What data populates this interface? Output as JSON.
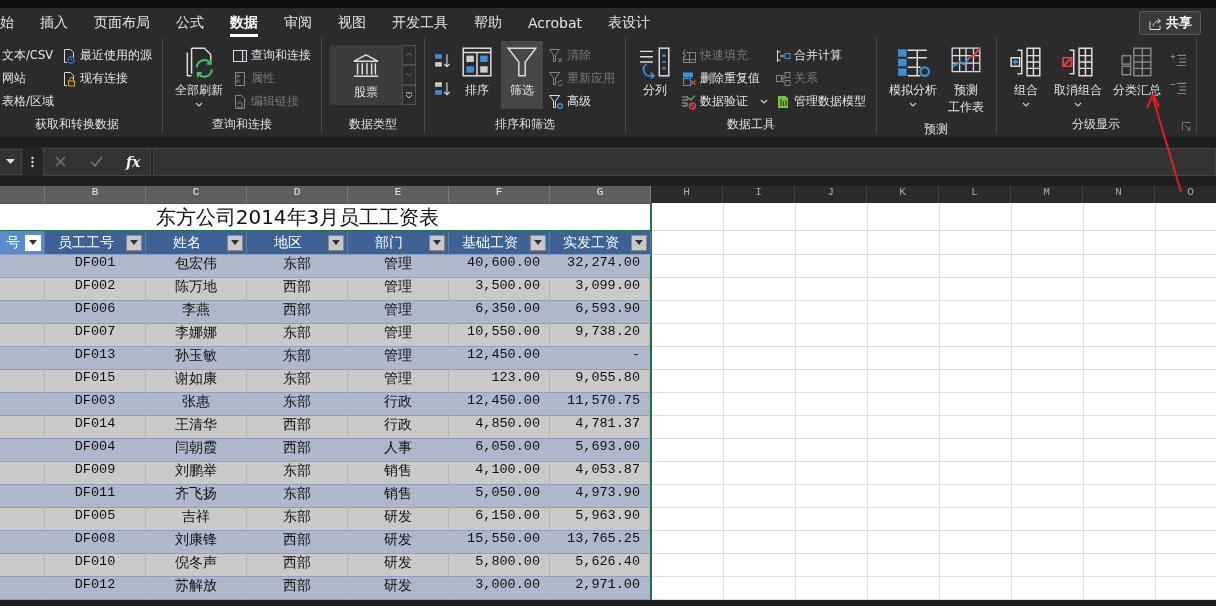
{
  "tabs": [
    {
      "label": "始",
      "selected": false
    },
    {
      "label": "插入",
      "selected": false
    },
    {
      "label": "页面布局",
      "selected": false
    },
    {
      "label": "公式",
      "selected": false
    },
    {
      "label": "数据",
      "selected": true
    },
    {
      "label": "审阅",
      "selected": false
    },
    {
      "label": "视图",
      "selected": false
    },
    {
      "label": "开发工具",
      "selected": false
    },
    {
      "label": "帮助",
      "selected": false
    },
    {
      "label": "Acrobat",
      "selected": false
    },
    {
      "label": "表设计",
      "selected": false
    }
  ],
  "share_button": {
    "label": "共享"
  },
  "ribbon": {
    "groups": [
      {
        "label": "获取和转换数据",
        "launcher": false,
        "columns": [
          {
            "kind": "stack",
            "items": [
              {
                "label": "文本/CSV",
                "disabled": false,
                "dropdown": false
              },
              {
                "label": "网站",
                "disabled": false,
                "dropdown": false
              },
              {
                "label": "表格/区域",
                "disabled": false,
                "dropdown": false
              }
            ]
          },
          {
            "kind": "stack",
            "items": [
              {
                "label": "最近使用的源",
                "disabled": false,
                "dropdown": false
              },
              {
                "label": "现有连接",
                "disabled": false,
                "dropdown": false
              }
            ]
          }
        ]
      },
      {
        "label": "查询和连接",
        "launcher": false,
        "columns": [
          {
            "kind": "large",
            "items": [
              {
                "lines": [
                  "全部刷新"
                ],
                "disabled": false,
                "dropdown": true,
                "pressed": false
              }
            ]
          },
          {
            "kind": "stack",
            "items": [
              {
                "label": "查询和连接",
                "disabled": false,
                "dropdown": false
              },
              {
                "label": "属性",
                "disabled": true,
                "dropdown": false
              },
              {
                "label": "编辑链接",
                "disabled": true,
                "dropdown": false
              }
            ]
          }
        ]
      },
      {
        "label": "数据类型",
        "launcher": false,
        "columns": [
          {
            "kind": "gallery",
            "items": [
              {
                "label": "股票"
              }
            ]
          }
        ]
      },
      {
        "label": "排序和筛选",
        "launcher": false,
        "columns": [
          {
            "kind": "icons",
            "items": [
              {
                "disabled": false
              },
              {
                "disabled": false
              }
            ]
          },
          {
            "kind": "large",
            "items": [
              {
                "lines": [
                  "排序"
                ],
                "disabled": false,
                "dropdown": false,
                "pressed": false
              }
            ]
          },
          {
            "kind": "large",
            "items": [
              {
                "lines": [
                  "筛选"
                ],
                "disabled": false,
                "dropdown": false,
                "pressed": true
              }
            ]
          },
          {
            "kind": "stack",
            "items": [
              {
                "label": "清除",
                "disabled": true,
                "dropdown": false
              },
              {
                "label": "重新应用",
                "disabled": true,
                "dropdown": false
              },
              {
                "label": "高级",
                "disabled": false,
                "dropdown": false
              }
            ]
          }
        ]
      },
      {
        "label": "数据工具",
        "launcher": false,
        "columns": [
          {
            "kind": "large",
            "items": [
              {
                "lines": [
                  "分列"
                ],
                "disabled": false,
                "dropdown": false,
                "pressed": false
              }
            ]
          },
          {
            "kind": "stack",
            "items": [
              {
                "label": "快速填充",
                "disabled": true,
                "dropdown": false
              },
              {
                "label": "删除重复值",
                "disabled": false,
                "dropdown": false
              },
              {
                "label": "数据验证",
                "disabled": false,
                "dropdown": true
              }
            ]
          },
          {
            "kind": "stack",
            "items": [
              {
                "label": "合并计算",
                "disabled": false,
                "dropdown": false
              },
              {
                "label": "关系",
                "disabled": true,
                "dropdown": false
              },
              {
                "label": "管理数据模型",
                "disabled": false,
                "dropdown": false
              }
            ]
          }
        ]
      },
      {
        "label": "预测",
        "launcher": false,
        "columns": [
          {
            "kind": "large",
            "items": [
              {
                "lines": [
                  "模拟分析"
                ],
                "disabled": false,
                "dropdown": true,
                "pressed": false
              }
            ]
          },
          {
            "kind": "large",
            "items": [
              {
                "lines": [
                  "预测",
                  "工作表"
                ],
                "disabled": false,
                "dropdown": false,
                "pressed": false
              }
            ]
          }
        ]
      },
      {
        "label": "分级显示",
        "launcher": true,
        "columns": [
          {
            "kind": "large",
            "items": [
              {
                "lines": [
                  "组合"
                ],
                "disabled": false,
                "dropdown": true,
                "pressed": false
              }
            ]
          },
          {
            "kind": "large",
            "items": [
              {
                "lines": [
                  "取消组合"
                ],
                "disabled": false,
                "dropdown": true,
                "pressed": false
              }
            ]
          },
          {
            "kind": "large",
            "items": [
              {
                "lines": [
                  "分类汇总"
                ],
                "disabled": true,
                "dropdown": false,
                "pressed": false
              }
            ]
          },
          {
            "kind": "icons",
            "items": [
              {
                "disabled": true
              },
              {
                "disabled": true
              }
            ]
          }
        ]
      }
    ]
  },
  "formula_bar": {
    "function_label": "fx"
  },
  "sheet": {
    "columns": [
      {
        "selected": true
      },
      {
        "letter": "B",
        "selected": true
      },
      {
        "letter": "C",
        "selected": true
      },
      {
        "letter": "D",
        "selected": true
      },
      {
        "letter": "E",
        "selected": true
      },
      {
        "letter": "F",
        "selected": true
      },
      {
        "letter": "G",
        "selected": true
      },
      {
        "letter": "H",
        "selected": false
      },
      {
        "letter": "I",
        "selected": false
      },
      {
        "letter": "J",
        "selected": false
      },
      {
        "letter": "K",
        "selected": false
      },
      {
        "letter": "L",
        "selected": false
      },
      {
        "letter": "M",
        "selected": false
      },
      {
        "letter": "N",
        "selected": false
      },
      {
        "letter": "O",
        "selected": false
      }
    ]
  },
  "table": {
    "title": "东方公司2014年3月员工工资表",
    "columns": [
      {
        "label": "号",
        "selected": true
      },
      {
        "label": "员工工号",
        "selected": false
      },
      {
        "label": "姓名",
        "selected": false
      },
      {
        "label": "地区",
        "selected": false
      },
      {
        "label": "部门",
        "selected": false
      },
      {
        "label": "基础工资",
        "selected": false
      },
      {
        "label": "实发工资",
        "selected": false
      }
    ],
    "rows": [
      [
        "",
        "DF001",
        "包宏伟",
        "东部",
        "管理",
        "40,600.00",
        "32,274.00"
      ],
      [
        "",
        "DF002",
        "陈万地",
        "西部",
        "管理",
        "3,500.00",
        "3,099.00"
      ],
      [
        "",
        "DF006",
        "李燕",
        "西部",
        "管理",
        "6,350.00",
        "6,593.90"
      ],
      [
        "",
        "DF007",
        "李娜娜",
        "东部",
        "管理",
        "10,550.00",
        "9,738.20"
      ],
      [
        "",
        "DF013",
        "孙玉敏",
        "东部",
        "管理",
        "12,450.00",
        "-"
      ],
      [
        "",
        "DF015",
        "谢如康",
        "东部",
        "管理",
        "123.00",
        "9,055.80"
      ],
      [
        "",
        "DF003",
        "张惠",
        "东部",
        "行政",
        "12,450.00",
        "11,570.75"
      ],
      [
        "",
        "DF014",
        "王清华",
        "西部",
        "行政",
        "4,850.00",
        "4,781.37"
      ],
      [
        "",
        "DF004",
        "闫朝霞",
        "西部",
        "人事",
        "6,050.00",
        "5,693.00"
      ],
      [
        "",
        "DF009",
        "刘鹏举",
        "东部",
        "销售",
        "4,100.00",
        "4,053.87"
      ],
      [
        "",
        "DF011",
        "齐飞扬",
        "东部",
        "销售",
        "5,050.00",
        "4,973.90"
      ],
      [
        "",
        "DF005",
        "吉祥",
        "东部",
        "研发",
        "6,150.00",
        "5,963.90"
      ],
      [
        "",
        "DF008",
        "刘康锋",
        "西部",
        "研发",
        "15,550.00",
        "13,765.25"
      ],
      [
        "",
        "DF010",
        "倪冬声",
        "西部",
        "研发",
        "5,800.00",
        "5,626.40"
      ],
      [
        "",
        "DF012",
        "苏解放",
        "西部",
        "研发",
        "3,000.00",
        "2,971.00"
      ]
    ]
  }
}
